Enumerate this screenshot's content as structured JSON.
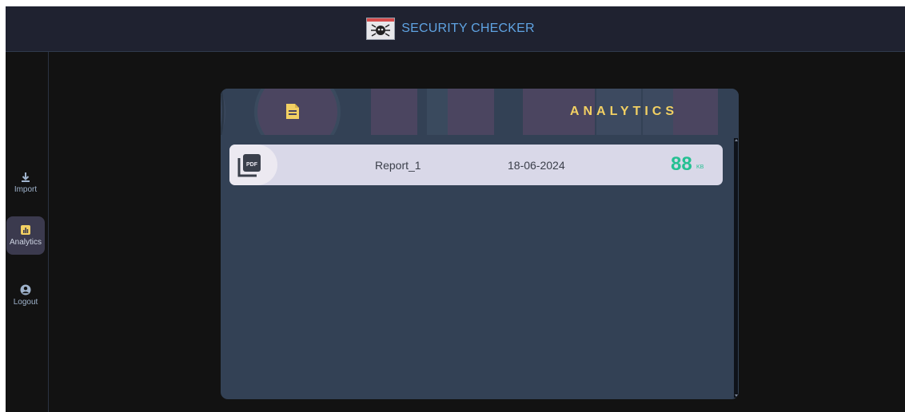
{
  "app": {
    "title": "SECURITY CHECKER",
    "accent_color": "#5fa3e2"
  },
  "sidebar": {
    "items": [
      {
        "label": "Import",
        "icon": "download-icon",
        "active": false
      },
      {
        "label": "Analytics",
        "icon": "analytics-icon",
        "active": true
      },
      {
        "label": "Logout",
        "icon": "user-circle-icon",
        "active": false
      }
    ]
  },
  "panel": {
    "title": "ANALYTICS",
    "title_color": "#f2d063",
    "header_icon": "document-icon",
    "files": [
      {
        "icon": "pdf-icon",
        "name": "Report_1",
        "date": "18-06-2024",
        "size": "88",
        "unit": "KB"
      }
    ]
  },
  "colors": {
    "panel_bg": "#334155",
    "row_bg": "#d9d8e8",
    "size_color": "#25c092"
  }
}
